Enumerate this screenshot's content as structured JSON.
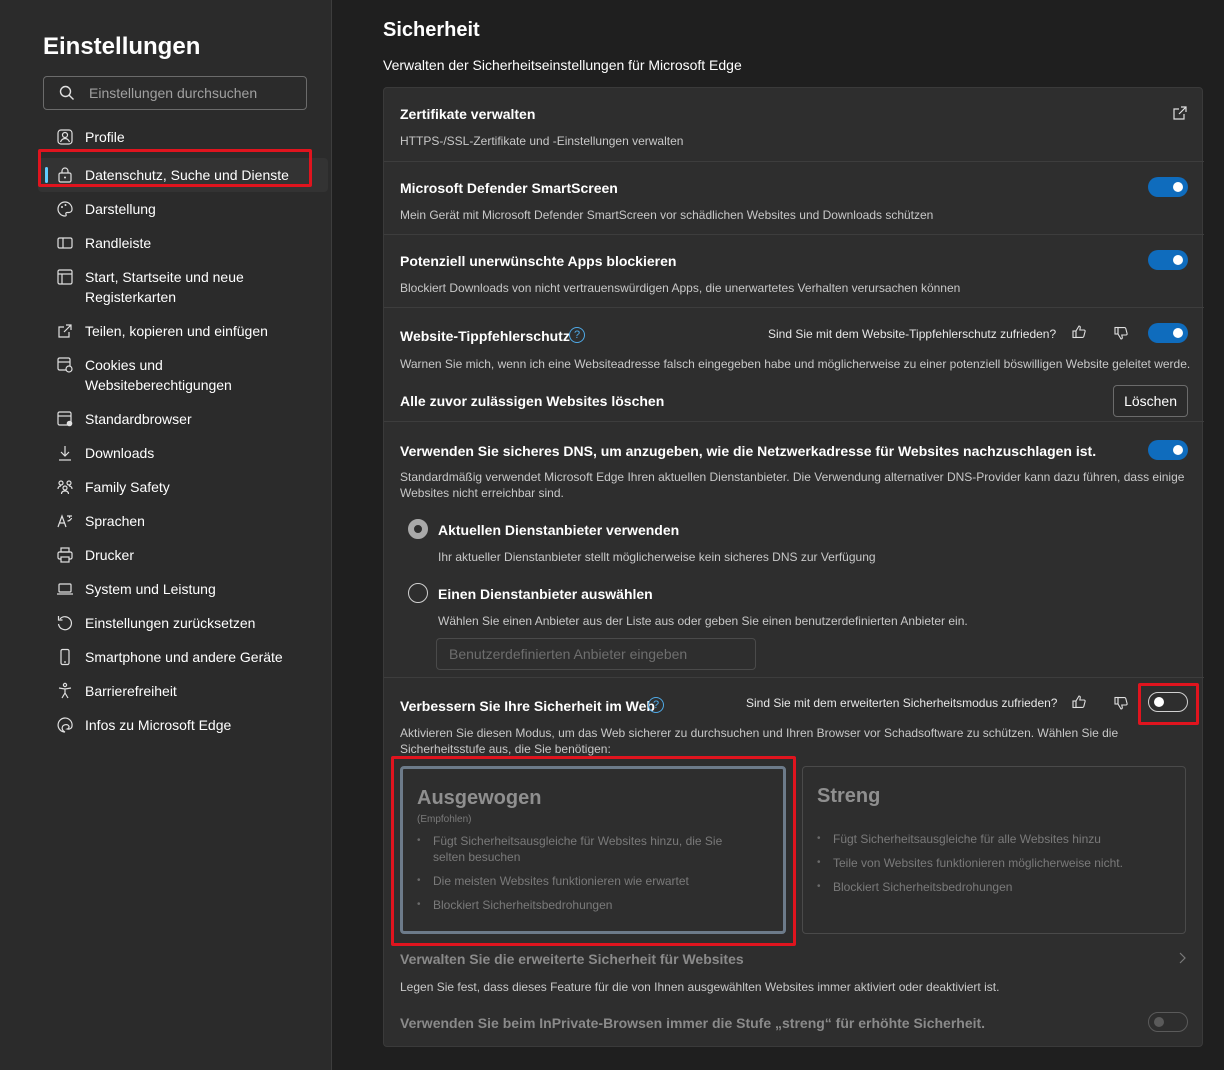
{
  "sidebar": {
    "title": "Einstellungen",
    "search_placeholder": "Einstellungen durchsuchen",
    "items": [
      {
        "label": "Profile",
        "icon": "profile-icon"
      },
      {
        "label": "Datenschutz, Suche und Dienste",
        "icon": "lock-icon"
      },
      {
        "label": "Darstellung",
        "icon": "palette-icon"
      },
      {
        "label": "Randleiste",
        "icon": "sidebar-icon"
      },
      {
        "label": "Start, Startseite und neue Registerkarten",
        "icon": "home-icon"
      },
      {
        "label": "Teilen, kopieren und einfügen",
        "icon": "share-icon"
      },
      {
        "label": "Cookies und Websiteberechtigungen",
        "icon": "cookie-icon"
      },
      {
        "label": "Standardbrowser",
        "icon": "browser-icon"
      },
      {
        "label": "Downloads",
        "icon": "download-icon"
      },
      {
        "label": "Family Safety",
        "icon": "family-icon"
      },
      {
        "label": "Sprachen",
        "icon": "language-icon"
      },
      {
        "label": "Drucker",
        "icon": "printer-icon"
      },
      {
        "label": "System und Leistung",
        "icon": "laptop-icon"
      },
      {
        "label": "Einstellungen zurücksetzen",
        "icon": "reset-icon"
      },
      {
        "label": "Smartphone und andere Geräte",
        "icon": "phone-icon"
      },
      {
        "label": "Barrierefreiheit",
        "icon": "accessibility-icon"
      },
      {
        "label": "Infos zu Microsoft Edge",
        "icon": "edge-icon"
      }
    ]
  },
  "main": {
    "title": "Sicherheit",
    "subtitle": "Verwalten der Sicherheitseinstellungen für Microsoft Edge",
    "certs": {
      "title": "Zertifikate verwalten",
      "desc": "HTTPS-/SSL-Zertifikate und -Einstellungen verwalten"
    },
    "smartscreen": {
      "title": "Microsoft Defender SmartScreen",
      "desc": "Mein Gerät mit Microsoft Defender SmartScreen vor schädlichen Websites und Downloads schützen"
    },
    "pua": {
      "title": "Potenziell unerwünschte Apps blockieren",
      "desc": "Blockiert Downloads von nicht vertrauenswürdigen Apps, die unerwartetes Verhalten verursachen können"
    },
    "typo": {
      "title": "Website-Tippfehlerschutz",
      "feedback": "Sind Sie mit dem Website-Tippfehlerschutz zufrieden?",
      "desc": "Warnen Sie mich, wenn ich eine Websiteadresse falsch eingegeben habe und möglicherweise zu einer potenziell böswilligen Website geleitet werde.",
      "clear_title": "Alle zuvor zulässigen Websites löschen",
      "clear_button": "Löschen"
    },
    "dns": {
      "title": "Verwenden Sie sicheres DNS, um anzugeben, wie die Netzwerkadresse für Websites nachzuschlagen ist.",
      "desc": "Standardmäßig verwendet Microsoft Edge Ihren aktuellen Dienstanbieter. Die Verwendung alternativer DNS-Provider kann dazu führen, dass einige Websites nicht erreichbar sind.",
      "opt1_title": "Aktuellen Dienstanbieter verwenden",
      "opt1_desc": "Ihr aktueller Dienstanbieter stellt möglicherweise kein sicheres DNS zur Verfügung",
      "opt2_title": "Einen Dienstanbieter auswählen",
      "opt2_desc": "Wählen Sie einen Anbieter aus der Liste aus oder geben Sie einen benutzerdefinierten Anbieter ein.",
      "input_placeholder": "Benutzerdefinierten Anbieter eingeben"
    },
    "enhanced": {
      "title": "Verbessern Sie Ihre Sicherheit im Web",
      "feedback": "Sind Sie mit dem erweiterten Sicherheitsmodus zufrieden?",
      "desc": "Aktivieren Sie diesen Modus, um das Web sicherer zu durchsuchen und Ihren Browser vor Schadsoftware zu schützen. Wählen Sie die Sicherheitsstufe aus, die Sie benötigen:",
      "balanced": {
        "title": "Ausgewogen",
        "sub": "(Empfohlen)",
        "items": [
          "Fügt Sicherheitsausgleiche für Websites hinzu, die Sie selten besuchen",
          "Die meisten Websites funktionieren wie erwartet",
          "Blockiert Sicherheitsbedrohungen"
        ]
      },
      "strict": {
        "title": "Streng",
        "items": [
          "Fügt Sicherheitsausgleiche für alle Websites hinzu",
          "Teile von Websites funktionieren möglicherweise nicht.",
          "Blockiert Sicherheitsbedrohungen"
        ]
      },
      "manage_title": "Verwalten Sie die erweiterte Sicherheit für Websites",
      "manage_desc": "Legen Sie fest, dass dieses Feature für die von Ihnen ausgewählten Websites immer aktiviert oder deaktiviert ist.",
      "inprivate_title": "Verwenden Sie beim InPrivate-Browsen immer die Stufe „streng“ für erhöhte Sicherheit."
    }
  },
  "colors": {
    "accent": "#0f6cbd",
    "highlight": "#e0141e",
    "nav_indicator": "#60cdff"
  }
}
